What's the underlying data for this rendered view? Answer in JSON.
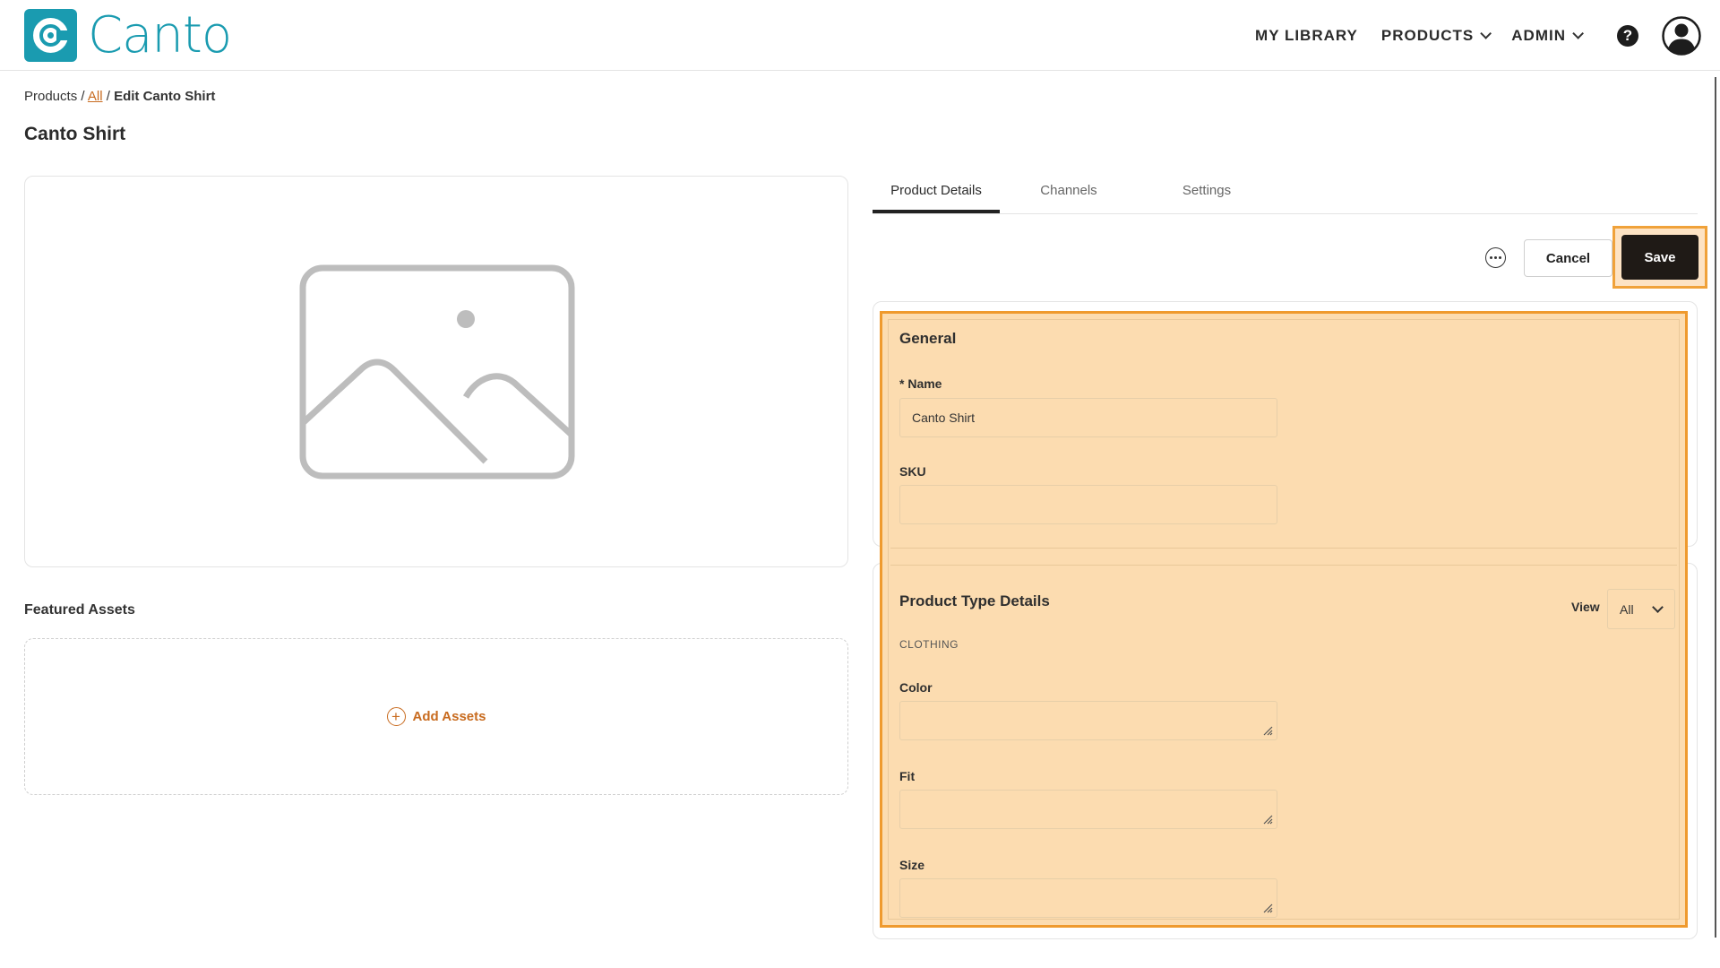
{
  "brand": {
    "name": "Canto",
    "color": "#1a9bb0"
  },
  "nav": {
    "my_library": "MY LIBRARY",
    "products": "PRODUCTS",
    "admin": "ADMIN",
    "help": "?"
  },
  "breadcrumb": {
    "root": "Products",
    "sep1": " / ",
    "link": "All",
    "sep2": " / ",
    "current": "Edit Canto Shirt"
  },
  "page_title": "Canto Shirt",
  "featured_assets": {
    "title": "Featured Assets",
    "add_label": "Add Assets"
  },
  "tabs": [
    {
      "label": "Product Details",
      "active": true
    },
    {
      "label": "Channels",
      "active": false
    },
    {
      "label": "Settings",
      "active": false
    }
  ],
  "actions": {
    "cancel": "Cancel",
    "save": "Save"
  },
  "general": {
    "title": "General",
    "name_label": "* Name",
    "name_value": "Canto Shirt",
    "sku_label": "SKU",
    "sku_value": ""
  },
  "product_type": {
    "title": "Product Type Details",
    "view_label": "View",
    "view_value": "All",
    "type_name": "CLOTHING",
    "fields": [
      {
        "label": "Color",
        "value": ""
      },
      {
        "label": "Fit",
        "value": ""
      },
      {
        "label": "Size",
        "value": ""
      }
    ]
  },
  "colors": {
    "accent": "#c86b1f",
    "highlight": "#ef9a2e",
    "save_bg": "#1f1a16"
  }
}
